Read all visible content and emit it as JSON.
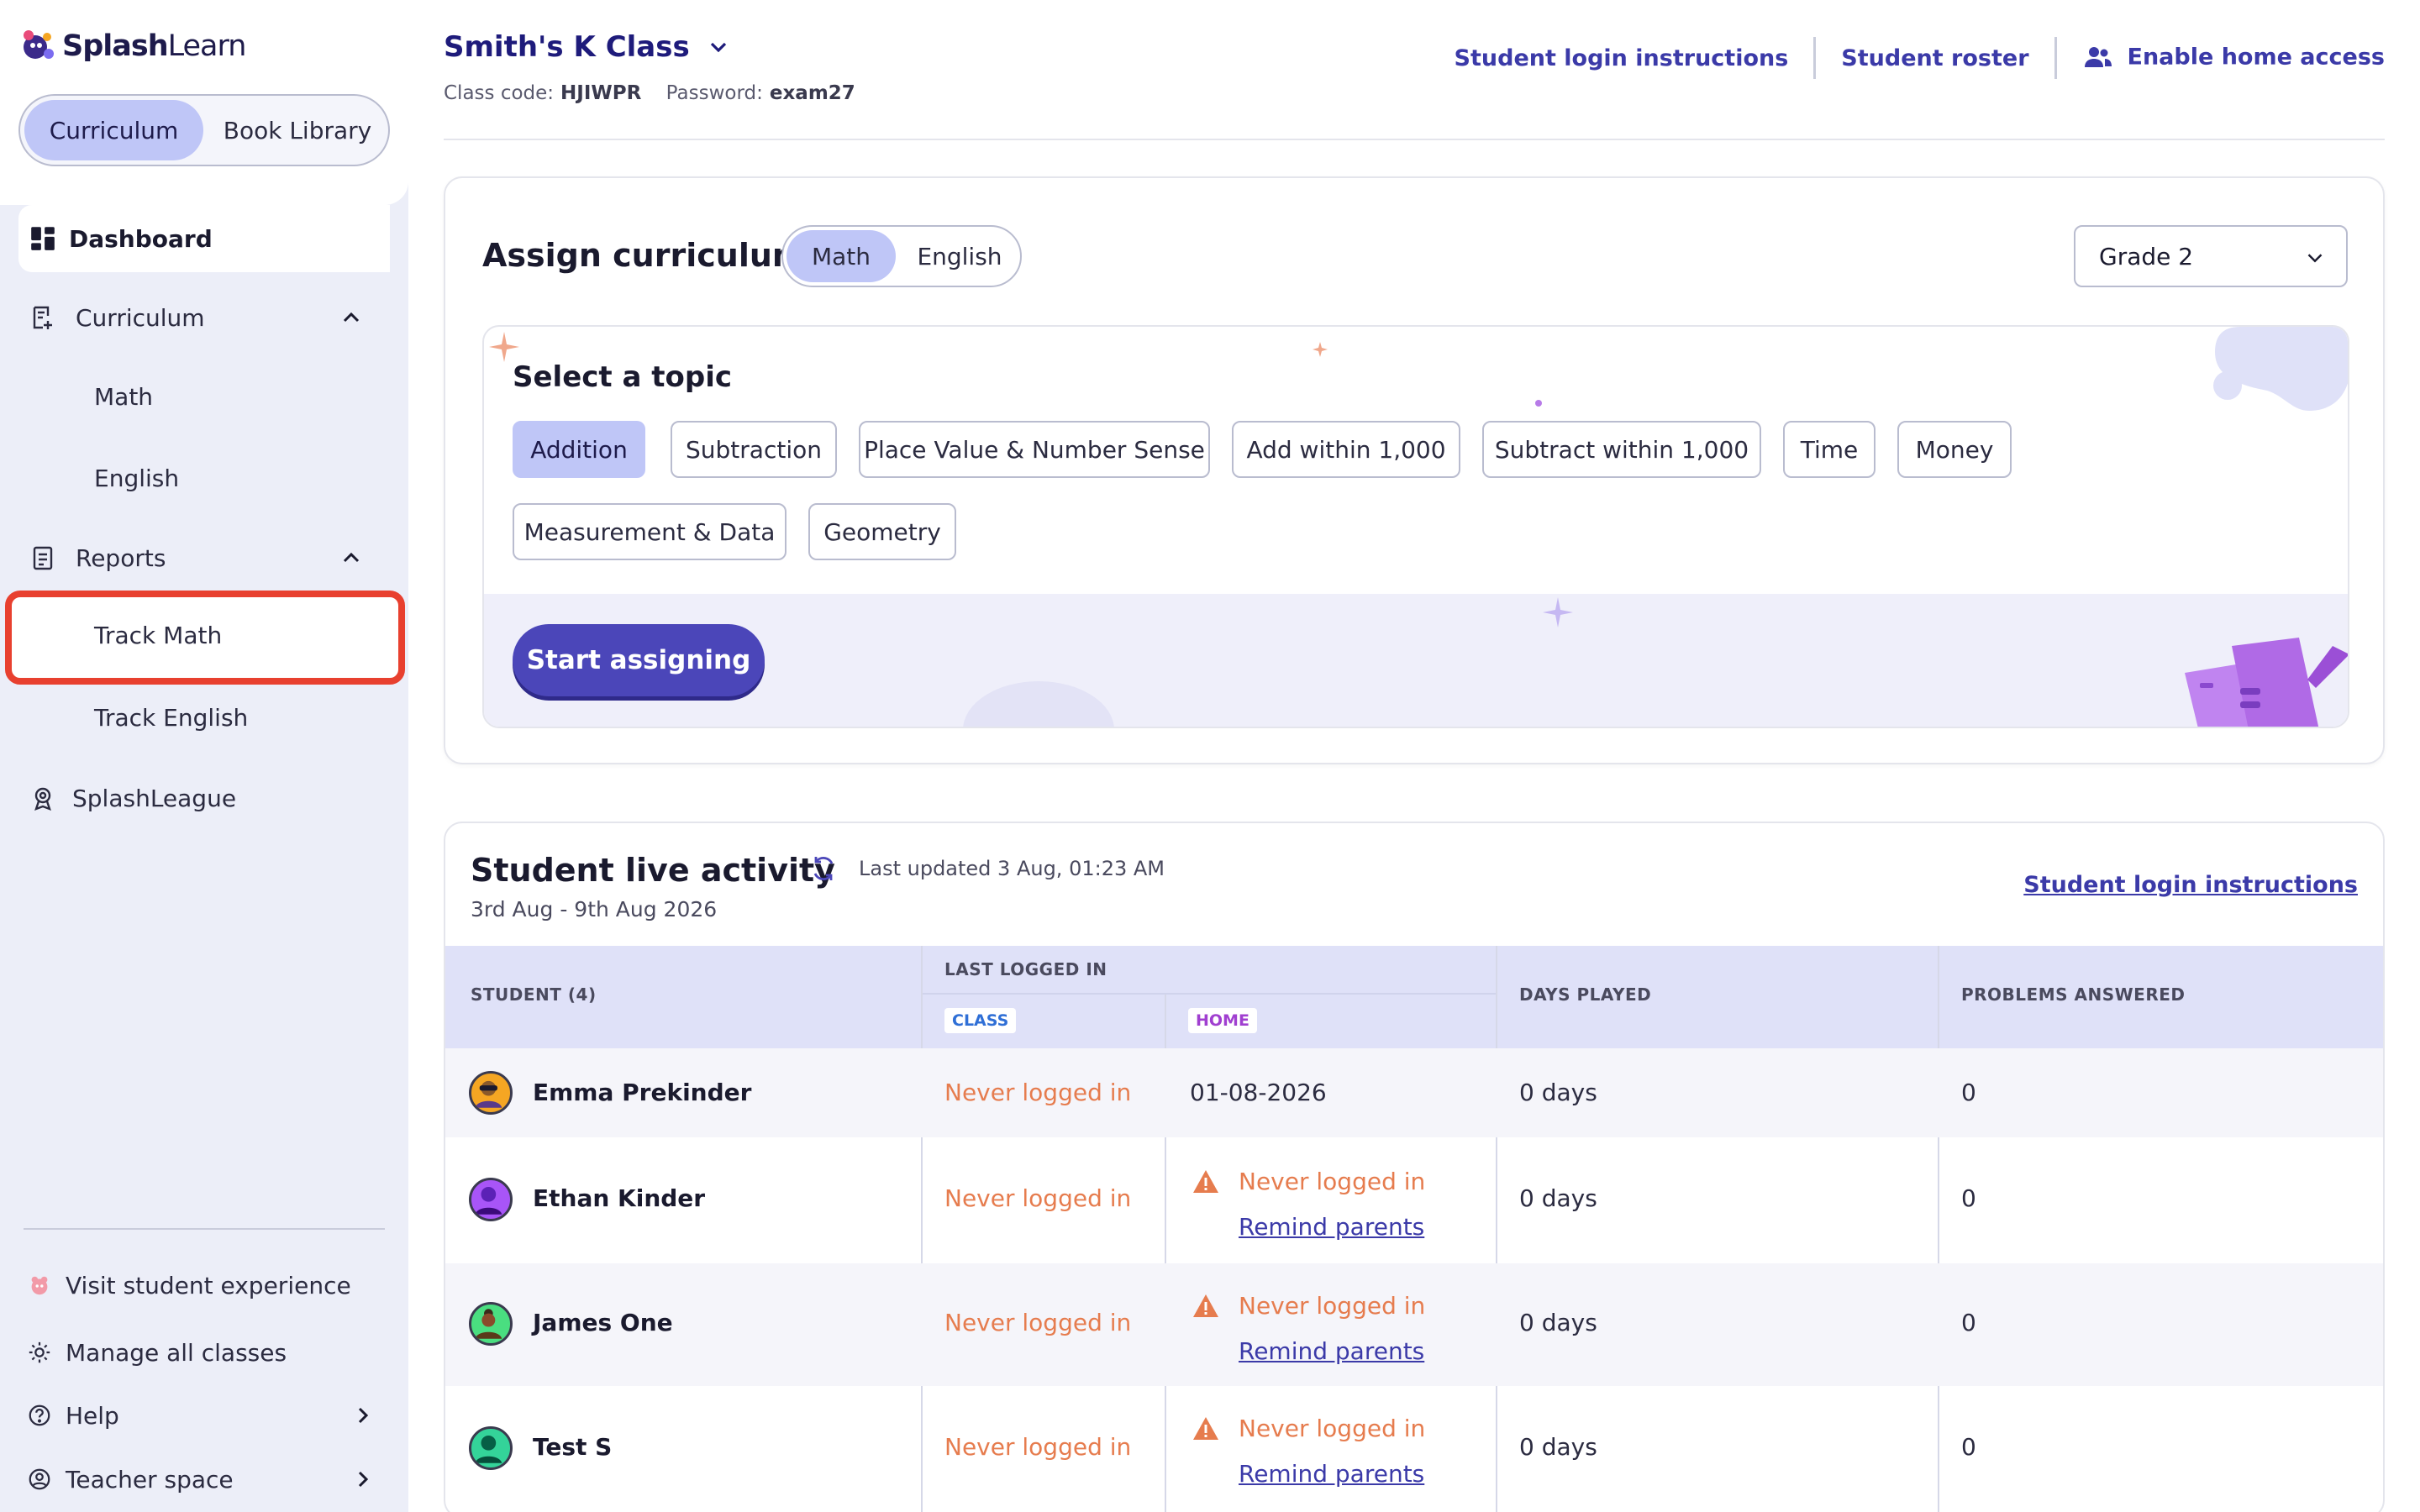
{
  "app": {
    "logo_bold": "Splash",
    "logo_light": "Learn"
  },
  "sidebar": {
    "library_toggle": {
      "active": "Curriculum",
      "inactive": "Book Library"
    },
    "dashboard": "Dashboard",
    "curriculum": {
      "label": "Curriculum",
      "items": [
        "Math",
        "English"
      ]
    },
    "reports": {
      "label": "Reports",
      "items": [
        "Track Math",
        "Track English"
      ]
    },
    "splashleague": "SplashLeague",
    "footer": {
      "visit": "Visit student experience",
      "manage": "Manage all classes",
      "help": "Help",
      "teacher": "Teacher space"
    }
  },
  "header": {
    "class_name": "Smith's K Class",
    "class_code_label": "Class code:",
    "class_code": "HJIWPR",
    "password_label": "Password:",
    "password": "exam27",
    "links": {
      "login": "Student login instructions",
      "roster": "Student roster",
      "home": "Enable home access"
    }
  },
  "assign": {
    "title": "Assign curriculum",
    "subjects": {
      "active": "Math",
      "inactive": "English"
    },
    "grade": "Grade 2",
    "topic_title": "Select a topic",
    "topics": [
      "Addition",
      "Subtraction",
      "Place Value & Number Sense",
      "Add within 1,000",
      "Subtract within 1,000",
      "Time",
      "Money",
      "Measurement & Data",
      "Geometry"
    ],
    "start_button": "Start assigning"
  },
  "activity": {
    "title": "Student live activity",
    "updated": "Last updated 3 Aug, 01:23 AM",
    "range": "3rd Aug - 9th Aug 2026",
    "login_link": "Student login instructions",
    "headers": {
      "student": "STUDENT (4)",
      "last_logged": "LAST LOGGED IN",
      "class": "CLASS",
      "home": "HOME",
      "days": "DAYS PLAYED",
      "problems": "PROBLEMS ANSWERED"
    },
    "remind_label": "Remind parents",
    "rows": [
      {
        "name": "Emma Prekinder",
        "class": "Never logged in",
        "home": "01-08-2026",
        "days": "0 days",
        "problems": "0"
      },
      {
        "name": "Ethan Kinder",
        "class": "Never logged in",
        "home": "Never logged in",
        "days": "0 days",
        "problems": "0"
      },
      {
        "name": "James One",
        "class": "Never logged in",
        "home": "Never logged in",
        "days": "0 days",
        "problems": "0"
      },
      {
        "name": "Test S",
        "class": "Never logged in",
        "home": "Never logged in",
        "days": "0 days",
        "problems": "0"
      }
    ]
  },
  "colors": {
    "brand": "#4b46b9",
    "accent_light": "#bfc6f7",
    "warning": "#e67c4e",
    "highlight": "#e8402f"
  }
}
